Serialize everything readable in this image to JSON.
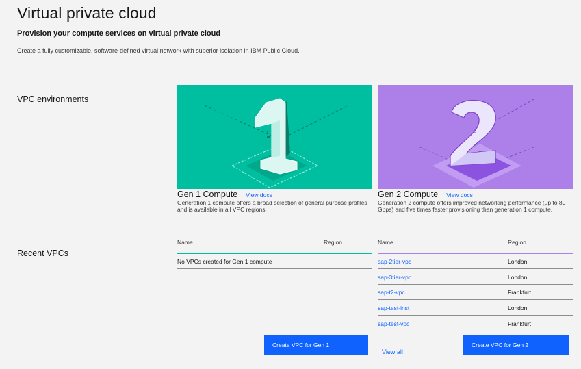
{
  "header": {
    "title": "Virtual private cloud",
    "subtitle": "Provision your compute services on virtual private cloud",
    "description": "Create a fully customizable, software-defined virtual network with superior isolation in IBM Public Cloud."
  },
  "sections": {
    "environments": "VPC environments",
    "recent": "Recent VPCs"
  },
  "gen1": {
    "title": "Gen 1 Compute",
    "docs_link": "View docs",
    "description": "Generation 1 compute offers a broad selection of general purpose profiles and is available in all VPC regions.",
    "illustration_numeral": "1",
    "table": {
      "headers": [
        "Name",
        "Region"
      ],
      "empty_message": "No VPCs created for Gen 1 compute"
    },
    "create_button": "Create VPC for Gen 1"
  },
  "gen2": {
    "title": "Gen 2 Compute",
    "docs_link": "View docs",
    "description": "Generation 2 compute offers improved networking performance (up to 80 Gbps) and five times faster provisioning than generation 1 compute.",
    "illustration_numeral": "2",
    "table": {
      "headers": [
        "Name",
        "Region"
      ],
      "rows": [
        {
          "name": "sap-2tier-vpc",
          "region": "London"
        },
        {
          "name": "sap-3tier-vpc",
          "region": "London"
        },
        {
          "name": "sap-t2-vpc",
          "region": "Frankfurt"
        },
        {
          "name": "sap-test-inst",
          "region": "London"
        },
        {
          "name": "sap-test-vpc",
          "region": "Frankfurt"
        }
      ]
    },
    "view_all": "View all",
    "create_button": "Create VPC for Gen 2"
  },
  "colors": {
    "gen1_accent": "#00bfa0",
    "gen2_accent": "#ac7fe9",
    "link": "#0f62fe",
    "button": "#0f62fe",
    "background": "#f3f3f3"
  }
}
